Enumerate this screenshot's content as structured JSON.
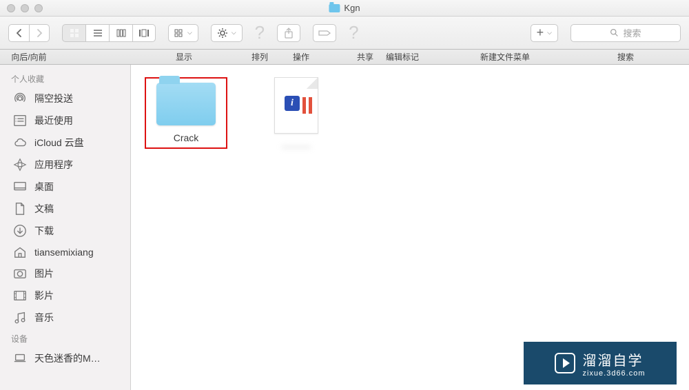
{
  "window": {
    "title": "Kgn"
  },
  "toolbar": {
    "nav_label": "向后/向前",
    "view_label": "显示",
    "arrange_label": "排列",
    "operate_label": "操作",
    "share_label": "共享",
    "tags_label": "编辑标记",
    "new_label": "新建文件菜单",
    "search_label": "搜索",
    "search_placeholder": "搜索"
  },
  "sidebar": {
    "favorites_header": "个人收藏",
    "devices_header": "设备",
    "items": [
      {
        "icon": "airdrop",
        "label": "隔空投送"
      },
      {
        "icon": "recent",
        "label": "最近使用"
      },
      {
        "icon": "icloud",
        "label": "iCloud 云盘"
      },
      {
        "icon": "apps",
        "label": "应用程序"
      },
      {
        "icon": "desktop",
        "label": "桌面"
      },
      {
        "icon": "documents",
        "label": "文稿"
      },
      {
        "icon": "downloads",
        "label": "下载"
      },
      {
        "icon": "home",
        "label": "tiansemixiang"
      },
      {
        "icon": "pictures",
        "label": "图片"
      },
      {
        "icon": "movies",
        "label": "影片"
      },
      {
        "icon": "music",
        "label": "音乐"
      }
    ],
    "devices": [
      {
        "icon": "laptop",
        "label": "天色迷香的M…"
      }
    ]
  },
  "content": {
    "items": [
      {
        "type": "folder",
        "label": "Crack",
        "highlighted": true
      },
      {
        "type": "document",
        "label": "———",
        "blurred": true
      }
    ]
  },
  "watermark": {
    "title": "溜溜自学",
    "url": "zixue.3d66.com"
  }
}
